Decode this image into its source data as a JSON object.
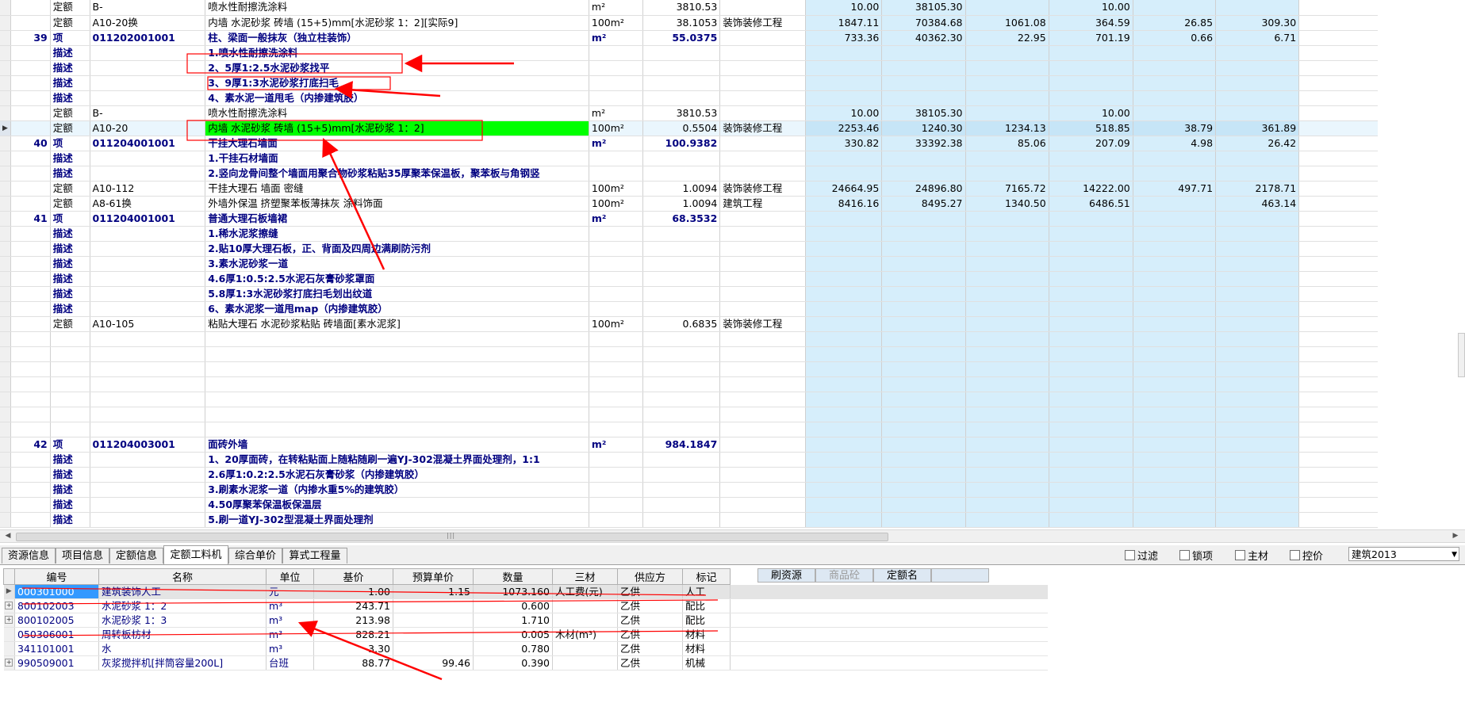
{
  "main_grid": {
    "rows": [
      {
        "no": "",
        "type": "定额",
        "code": "B-",
        "name": "喷水性耐擦洗涂料",
        "unit": "m²",
        "qty": "3810.53",
        "spec": "",
        "v1": "10.00",
        "v2": "38105.30",
        "v3": "",
        "v4": "10.00",
        "v5": "",
        "v6": "",
        "kind": "norm"
      },
      {
        "no": "",
        "type": "定额",
        "code": "A10-20换",
        "name": "内墙 水泥砂浆 砖墙 (15+5)mm[水泥砂浆 1：2][实际9]",
        "unit": "100m²",
        "qty": "38.1053",
        "spec": "装饰装修工程",
        "v1": "1847.11",
        "v2": "70384.68",
        "v3": "1061.08",
        "v4": "364.59",
        "v5": "26.85",
        "v6": "309.30",
        "kind": "norm"
      },
      {
        "no": "39",
        "type": "项",
        "code": "011202001001",
        "name": "柱、梁面一般抹灰（独立柱装饰）",
        "unit": "m²",
        "qty": "55.0375",
        "spec": "",
        "v1": "733.36",
        "v2": "40362.30",
        "v3": "22.95",
        "v4": "701.19",
        "v5": "0.66",
        "v6": "6.71",
        "kind": "item"
      },
      {
        "no": "",
        "type": "描述",
        "code": "",
        "name": "1.喷水性耐擦洗涂料",
        "unit": "",
        "qty": "",
        "spec": "",
        "v1": "",
        "v2": "",
        "v3": "",
        "v4": "",
        "v5": "",
        "v6": "",
        "kind": "desc"
      },
      {
        "no": "",
        "type": "描述",
        "code": "",
        "name": "2、5厚1:2.5水泥砂浆找平",
        "unit": "",
        "qty": "",
        "spec": "",
        "v1": "",
        "v2": "",
        "v3": "",
        "v4": "",
        "v5": "",
        "v6": "",
        "kind": "desc"
      },
      {
        "no": "",
        "type": "描述",
        "code": "",
        "name": "3、9厚1:3水泥砂浆打底扫毛",
        "unit": "",
        "qty": "",
        "spec": "",
        "v1": "",
        "v2": "",
        "v3": "",
        "v4": "",
        "v5": "",
        "v6": "",
        "kind": "desc"
      },
      {
        "no": "",
        "type": "描述",
        "code": "",
        "name": "4、素水泥一道甩毛（内掺建筑胶）",
        "unit": "",
        "qty": "",
        "spec": "",
        "v1": "",
        "v2": "",
        "v3": "",
        "v4": "",
        "v5": "",
        "v6": "",
        "kind": "desc"
      },
      {
        "no": "",
        "type": "定额",
        "code": "B-",
        "name": "喷水性耐擦洗涂料",
        "unit": "m²",
        "qty": "3810.53",
        "spec": "",
        "v1": "10.00",
        "v2": "38105.30",
        "v3": "",
        "v4": "10.00",
        "v5": "",
        "v6": "",
        "kind": "norm"
      },
      {
        "no": "",
        "type": "定额",
        "code": "A10-20",
        "name": "内墙 水泥砂浆 砖墙 (15+5)mm[水泥砂浆 1：2]",
        "unit": "100m²",
        "qty": "0.5504",
        "spec": "装饰装修工程",
        "v1": "2253.46",
        "v2": "1240.30",
        "v3": "1234.13",
        "v4": "518.85",
        "v5": "38.79",
        "v6": "361.89",
        "kind": "current"
      },
      {
        "no": "40",
        "type": "项",
        "code": "011204001001",
        "name": "干挂大理石墙面",
        "unit": "m²",
        "qty": "100.9382",
        "spec": "",
        "v1": "330.82",
        "v2": "33392.38",
        "v3": "85.06",
        "v4": "207.09",
        "v5": "4.98",
        "v6": "26.42",
        "kind": "item"
      },
      {
        "no": "",
        "type": "描述",
        "code": "",
        "name": "1.干挂石材墙面",
        "unit": "",
        "qty": "",
        "spec": "",
        "v1": "",
        "v2": "",
        "v3": "",
        "v4": "",
        "v5": "",
        "v6": "",
        "kind": "desc"
      },
      {
        "no": "",
        "type": "描述",
        "code": "",
        "name": "2.竖向龙骨间整个墙面用聚合物砂浆粘贴35厚聚苯保温板，聚苯板与角钢竖",
        "unit": "",
        "qty": "",
        "spec": "",
        "v1": "",
        "v2": "",
        "v3": "",
        "v4": "",
        "v5": "",
        "v6": "",
        "kind": "desc"
      },
      {
        "no": "",
        "type": "定额",
        "code": "A10-112",
        "name": "干挂大理石 墙面 密缝",
        "unit": "100m²",
        "qty": "1.0094",
        "spec": "装饰装修工程",
        "v1": "24664.95",
        "v2": "24896.80",
        "v3": "7165.72",
        "v4": "14222.00",
        "v5": "497.71",
        "v6": "2178.71",
        "kind": "norm"
      },
      {
        "no": "",
        "type": "定额",
        "code": "A8-61换",
        "name": "外墙外保温 挤塑聚苯板薄抹灰 涂料饰面",
        "unit": "100m²",
        "qty": "1.0094",
        "spec": "建筑工程",
        "v1": "8416.16",
        "v2": "8495.27",
        "v3": "1340.50",
        "v4": "6486.51",
        "v5": "",
        "v6": "463.14",
        "kind": "norm"
      },
      {
        "no": "41",
        "type": "项",
        "code": "011204001001",
        "name": "普通大理石板墙裙",
        "unit": "m²",
        "qty": "68.3532",
        "spec": "",
        "v1": "",
        "v2": "",
        "v3": "",
        "v4": "",
        "v5": "",
        "v6": "",
        "kind": "item"
      },
      {
        "no": "",
        "type": "描述",
        "code": "",
        "name": "1.稀水泥浆擦缝",
        "unit": "",
        "qty": "",
        "spec": "",
        "v1": "",
        "v2": "",
        "v3": "",
        "v4": "",
        "v5": "",
        "v6": "",
        "kind": "desc"
      },
      {
        "no": "",
        "type": "描述",
        "code": "",
        "name": "2.贴10厚大理石板，正、背面及四周边满刷防污剂",
        "unit": "",
        "qty": "",
        "spec": "",
        "v1": "",
        "v2": "",
        "v3": "",
        "v4": "",
        "v5": "",
        "v6": "",
        "kind": "desc"
      },
      {
        "no": "",
        "type": "描述",
        "code": "",
        "name": "3.素水泥砂浆一道",
        "unit": "",
        "qty": "",
        "spec": "",
        "v1": "",
        "v2": "",
        "v3": "",
        "v4": "",
        "v5": "",
        "v6": "",
        "kind": "desc"
      },
      {
        "no": "",
        "type": "描述",
        "code": "",
        "name": "4.6厚1:0.5:2.5水泥石灰膏砂浆罩面",
        "unit": "",
        "qty": "",
        "spec": "",
        "v1": "",
        "v2": "",
        "v3": "",
        "v4": "",
        "v5": "",
        "v6": "",
        "kind": "desc"
      },
      {
        "no": "",
        "type": "描述",
        "code": "",
        "name": "5.8厚1:3水泥砂浆打底扫毛划出纹道",
        "unit": "",
        "qty": "",
        "spec": "",
        "v1": "",
        "v2": "",
        "v3": "",
        "v4": "",
        "v5": "",
        "v6": "",
        "kind": "desc"
      },
      {
        "no": "",
        "type": "描述",
        "code": "",
        "name": "6、素水泥浆一道甩map（内掺建筑胶）",
        "unit": "",
        "qty": "",
        "spec": "",
        "v1": "",
        "v2": "",
        "v3": "",
        "v4": "",
        "v5": "",
        "v6": "",
        "kind": "desc"
      },
      {
        "no": "",
        "type": "定额",
        "code": "A10-105",
        "name": "粘贴大理石 水泥砂浆粘贴 砖墙面[素水泥浆]",
        "unit": "100m²",
        "qty": "0.6835",
        "spec": "装饰装修工程",
        "v1": "",
        "v2": "",
        "v3": "",
        "v4": "",
        "v5": "",
        "v6": "",
        "kind": "norm"
      },
      {
        "no": "",
        "type": "",
        "code": "",
        "name": "",
        "unit": "",
        "qty": "",
        "spec": "",
        "v1": "",
        "v2": "",
        "v3": "",
        "v4": "",
        "v5": "",
        "v6": "",
        "kind": "blank"
      },
      {
        "no": "",
        "type": "",
        "code": "",
        "name": "",
        "unit": "",
        "qty": "",
        "spec": "",
        "v1": "",
        "v2": "",
        "v3": "",
        "v4": "",
        "v5": "",
        "v6": "",
        "kind": "blank"
      },
      {
        "no": "",
        "type": "",
        "code": "",
        "name": "",
        "unit": "",
        "qty": "",
        "spec": "",
        "v1": "",
        "v2": "",
        "v3": "",
        "v4": "",
        "v5": "",
        "v6": "",
        "kind": "blank"
      },
      {
        "no": "",
        "type": "",
        "code": "",
        "name": "",
        "unit": "",
        "qty": "",
        "spec": "",
        "v1": "",
        "v2": "",
        "v3": "",
        "v4": "",
        "v5": "",
        "v6": "",
        "kind": "blank"
      },
      {
        "no": "",
        "type": "",
        "code": "",
        "name": "",
        "unit": "",
        "qty": "",
        "spec": "",
        "v1": "",
        "v2": "",
        "v3": "",
        "v4": "",
        "v5": "",
        "v6": "",
        "kind": "blank"
      },
      {
        "no": "",
        "type": "",
        "code": "",
        "name": "",
        "unit": "",
        "qty": "",
        "spec": "",
        "v1": "",
        "v2": "",
        "v3": "",
        "v4": "",
        "v5": "",
        "v6": "",
        "kind": "blank"
      },
      {
        "no": "",
        "type": "",
        "code": "",
        "name": "",
        "unit": "",
        "qty": "",
        "spec": "",
        "v1": "",
        "v2": "",
        "v3": "",
        "v4": "",
        "v5": "",
        "v6": "",
        "kind": "blank"
      },
      {
        "no": "42",
        "type": "项",
        "code": "011204003001",
        "name": "面砖外墙",
        "unit": "m²",
        "qty": "984.1847",
        "spec": "",
        "v1": "",
        "v2": "",
        "v3": "",
        "v4": "",
        "v5": "",
        "v6": "",
        "kind": "item"
      },
      {
        "no": "",
        "type": "描述",
        "code": "",
        "name": "1、20厚面砖，在转粘贴面上随粘随刷一遍YJ-302混凝土界面处理剂，1:1",
        "unit": "",
        "qty": "",
        "spec": "",
        "v1": "",
        "v2": "",
        "v3": "",
        "v4": "",
        "v5": "",
        "v6": "",
        "kind": "desc"
      },
      {
        "no": "",
        "type": "描述",
        "code": "",
        "name": "2.6厚1:0.2:2.5水泥石灰膏砂浆（内掺建筑胶）",
        "unit": "",
        "qty": "",
        "spec": "",
        "v1": "",
        "v2": "",
        "v3": "",
        "v4": "",
        "v5": "",
        "v6": "",
        "kind": "desc"
      },
      {
        "no": "",
        "type": "描述",
        "code": "",
        "name": "3.刷素水泥浆一道（内掺水重5%的建筑胶）",
        "unit": "",
        "qty": "",
        "spec": "",
        "v1": "",
        "v2": "",
        "v3": "",
        "v4": "",
        "v5": "",
        "v6": "",
        "kind": "desc"
      },
      {
        "no": "",
        "type": "描述",
        "code": "",
        "name": "4.50厚聚苯保温板保温层",
        "unit": "",
        "qty": "",
        "spec": "",
        "v1": "",
        "v2": "",
        "v3": "",
        "v4": "",
        "v5": "",
        "v6": "",
        "kind": "desc"
      },
      {
        "no": "",
        "type": "描述",
        "code": "",
        "name": "5.刷一道YJ-302型混凝土界面处理剂",
        "unit": "",
        "qty": "",
        "spec": "",
        "v1": "",
        "v2": "",
        "v3": "",
        "v4": "",
        "v5": "",
        "v6": "",
        "kind": "desc"
      }
    ]
  },
  "scrollbar": {
    "left_arrow": "◀",
    "right_arrow": "▶",
    "grip": "|||"
  },
  "tabs": [
    {
      "label": "资源信息",
      "active": false
    },
    {
      "label": "项目信息",
      "active": false
    },
    {
      "label": "定额信息",
      "active": false
    },
    {
      "label": "定额工料机",
      "active": true
    },
    {
      "label": "综合单价",
      "active": false
    },
    {
      "label": "算式工程量",
      "active": false
    }
  ],
  "filters": {
    "filter": "过滤",
    "lock": "锁项",
    "main_material": "主材",
    "control_price": "控价"
  },
  "standard_select": {
    "value": "建筑2013",
    "arrow": "▼"
  },
  "lower_table": {
    "headers": [
      "编号",
      "名称",
      "单位",
      "基价",
      "预算单价",
      "数量",
      "三材",
      "供应方",
      "标记"
    ],
    "rows": [
      {
        "expand": false,
        "code": "000301000",
        "name": "建筑装饰人工",
        "unit": "元",
        "base": "1.00",
        "budget": "1.15",
        "qty": "1073.160",
        "sancai": "人工费(元)",
        "supplier": "乙供",
        "mark": "人工",
        "selected": true
      },
      {
        "expand": true,
        "code": "800102003",
        "name": "水泥砂浆 1：2",
        "unit": "m³",
        "base": "243.71",
        "budget": "",
        "qty": "0.600",
        "sancai": "",
        "supplier": "乙供",
        "mark": "配比",
        "selected": false
      },
      {
        "expand": true,
        "code": "800102005",
        "name": "水泥砂浆 1：3",
        "unit": "m³",
        "base": "213.98",
        "budget": "",
        "qty": "1.710",
        "sancai": "",
        "supplier": "乙供",
        "mark": "配比",
        "selected": false
      },
      {
        "expand": false,
        "code": "050306001",
        "name": "周转板枋材",
        "unit": "m³",
        "base": "828.21",
        "budget": "",
        "qty": "0.005",
        "sancai": "木材(m³)",
        "supplier": "乙供",
        "mark": "材料",
        "selected": false
      },
      {
        "expand": false,
        "code": "341101001",
        "name": "水",
        "unit": "m³",
        "base": "3.30",
        "budget": "",
        "qty": "0.780",
        "sancai": "",
        "supplier": "乙供",
        "mark": "材料",
        "selected": false
      },
      {
        "expand": true,
        "code": "990509001",
        "name": "灰浆搅拌机[拌筒容量200L]",
        "unit": "台班",
        "base": "88.77",
        "budget": "99.46",
        "qty": "0.390",
        "sancai": "",
        "supplier": "乙供",
        "mark": "机械",
        "selected": false
      }
    ]
  },
  "right_tabs": [
    {
      "label": "刷资源",
      "dim": false
    },
    {
      "label": "商品砼",
      "dim": true
    },
    {
      "label": "定额名",
      "dim": false
    }
  ],
  "colors": {
    "highlight": "#00ff00",
    "money_col_bg": "#d6eefb",
    "annotation": "#ff0000",
    "item_text": "#000080"
  }
}
